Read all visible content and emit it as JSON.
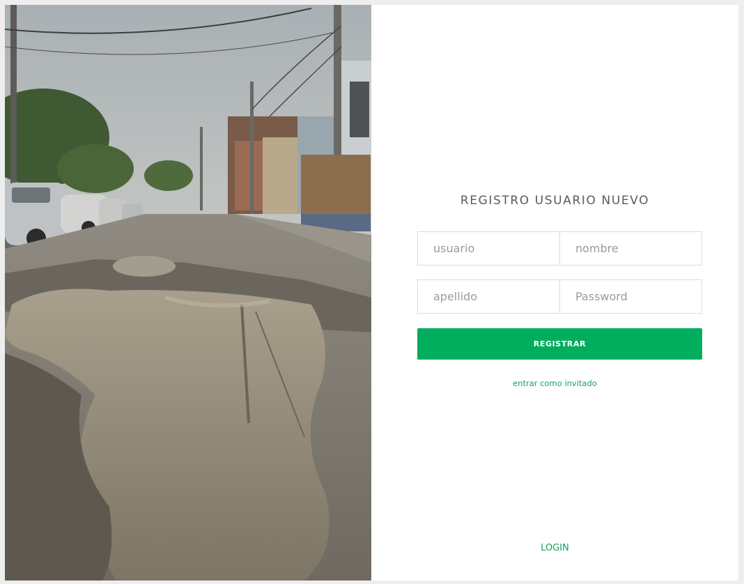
{
  "form": {
    "title": "REGISTRO USUARIO NUEVO",
    "fields": {
      "usuario_placeholder": "usuario",
      "nombre_placeholder": "nombre",
      "apellido_placeholder": "apellido",
      "password_placeholder": "Password"
    },
    "submit_label": "REGISTRAR",
    "guest_link": "entrar como invitado",
    "login_link": "LOGIN"
  },
  "colors": {
    "accent": "#02ad5e",
    "link": "#12a35c",
    "title_text": "#5a5a5a",
    "field_border": "#dcdcdc"
  }
}
